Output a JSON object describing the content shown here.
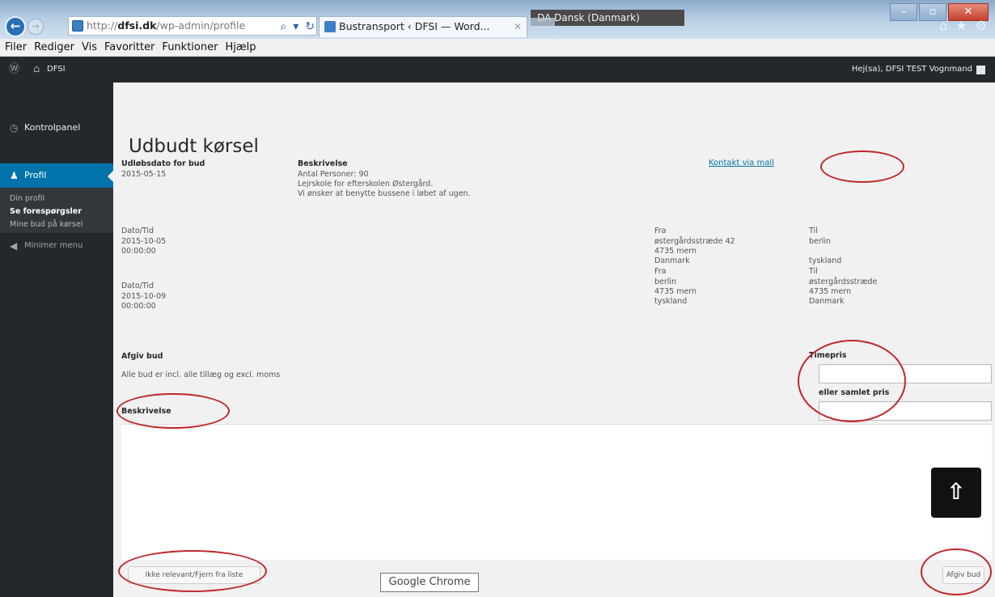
{
  "browser": {
    "language_indicator": "DA Dansk (Danmark)",
    "address": {
      "prefix": "http://",
      "host": "dfsi.dk",
      "path": "/wp-admin/profile"
    },
    "tab_title": "Bustransport ‹ DFSI — Word...",
    "menu": [
      "Filer",
      "Rediger",
      "Vis",
      "Favoritter",
      "Funktioner",
      "Hjælp"
    ]
  },
  "adminbar": {
    "site_name": "DFSI",
    "greeting": "Hej(sa), DFSI TEST Vognmand"
  },
  "sidebar": {
    "dashboard": "Kontrolpanel",
    "profile": "Profil",
    "submenu": [
      "Din profil",
      "Se forespørgsler",
      "Mine bud på kørsel"
    ],
    "collapse": "Minimer menu"
  },
  "main": {
    "title": "Udbudt kørsel",
    "expiry_label": "Udløbsdato for bud",
    "expiry_value": "2015-05-15",
    "description_label": "Beskrivelse",
    "description_lines": [
      "Antal Personer: 90",
      "Lejrskole for efterskolen Østergård.",
      "Vi ønsker at benytte bussene i løbet af ugen."
    ],
    "contact_link": "Kontakt via mail",
    "trips": [
      {
        "datetime_label": "Dato/Tid",
        "date": "2015-10-05",
        "time": "00:00:00",
        "from_label": "Fra",
        "from": [
          "østergårdsstræde 42",
          "4735 mern",
          "Danmark"
        ],
        "to_label": "Til",
        "to": [
          "berlin",
          "",
          "tyskland"
        ]
      },
      {
        "datetime_label": "Dato/Tid",
        "date": "2015-10-09",
        "time": "00:00:00",
        "from_label": "Fra",
        "from": [
          "berlin",
          "4735 mern",
          "tyskland"
        ],
        "to_label": "Til",
        "to": [
          "østergårdsstræde",
          "4735 mern",
          "Danmark"
        ]
      }
    ],
    "bid_label": "Afgiv bud",
    "bid_note": "Alle bud er incl. alle tillæg og excl. moms",
    "hourly_price_label": "Timepris",
    "total_price_label": "eller samlet pris",
    "bid_description_label": "Beskrivelse",
    "not_relevant_button": "Ikke relevant/Fjern fra liste",
    "submit_bid_button": "Afgiv bud",
    "chrome_tooltip": "Google Chrome"
  }
}
